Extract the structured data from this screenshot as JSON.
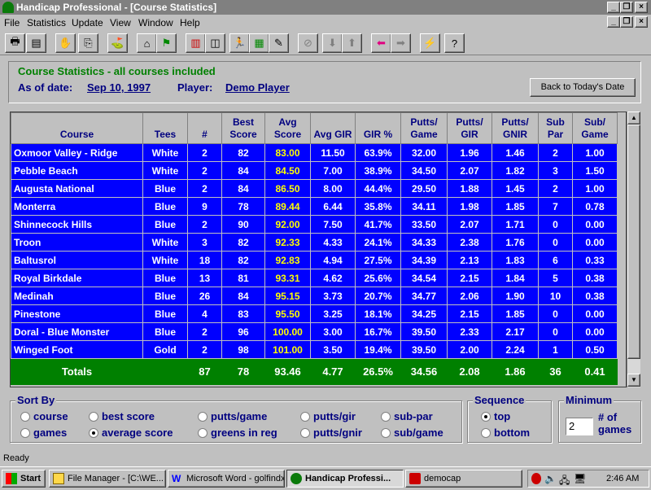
{
  "window": {
    "title": "Handicap Professional - [Course Statistics]"
  },
  "menu": [
    "File",
    "Statistics",
    "Update",
    "View",
    "Window",
    "Help"
  ],
  "header": {
    "title": "Course Statistics  -  all courses included",
    "as_of_label": "As of date:",
    "as_of_value": "Sep 10, 1997",
    "player_label": "Player:",
    "player_value": "Demo Player",
    "back_button": "Back to Today's Date"
  },
  "table": {
    "columns": [
      "Course",
      "Tees",
      "#",
      "Best Score",
      "Avg Score",
      "Avg GIR",
      "GIR %",
      "Putts/ Game",
      "Putts/ GIR",
      "Putts/ GNIR",
      "Sub Par",
      "Sub/ Game"
    ],
    "rows": [
      [
        "Oxmoor Valley - Ridge",
        "White",
        "2",
        "82",
        "83.00",
        "11.50",
        "63.9%",
        "32.00",
        "1.96",
        "1.46",
        "2",
        "1.00"
      ],
      [
        "Pebble Beach",
        "White",
        "2",
        "84",
        "84.50",
        "7.00",
        "38.9%",
        "34.50",
        "2.07",
        "1.82",
        "3",
        "1.50"
      ],
      [
        "Augusta National",
        "Blue",
        "2",
        "84",
        "86.50",
        "8.00",
        "44.4%",
        "29.50",
        "1.88",
        "1.45",
        "2",
        "1.00"
      ],
      [
        "Monterra",
        "Blue",
        "9",
        "78",
        "89.44",
        "6.44",
        "35.8%",
        "34.11",
        "1.98",
        "1.85",
        "7",
        "0.78"
      ],
      [
        "Shinnecock Hills",
        "Blue",
        "2",
        "90",
        "92.00",
        "7.50",
        "41.7%",
        "33.50",
        "2.07",
        "1.71",
        "0",
        "0.00"
      ],
      [
        "Troon",
        "White",
        "3",
        "82",
        "92.33",
        "4.33",
        "24.1%",
        "34.33",
        "2.38",
        "1.76",
        "0",
        "0.00"
      ],
      [
        "Baltusrol",
        "White",
        "18",
        "82",
        "92.83",
        "4.94",
        "27.5%",
        "34.39",
        "2.13",
        "1.83",
        "6",
        "0.33"
      ],
      [
        "Royal Birkdale",
        "Blue",
        "13",
        "81",
        "93.31",
        "4.62",
        "25.6%",
        "34.54",
        "2.15",
        "1.84",
        "5",
        "0.38"
      ],
      [
        "Medinah",
        "Blue",
        "26",
        "84",
        "95.15",
        "3.73",
        "20.7%",
        "34.77",
        "2.06",
        "1.90",
        "10",
        "0.38"
      ],
      [
        "Pinestone",
        "Blue",
        "4",
        "83",
        "95.50",
        "3.25",
        "18.1%",
        "34.25",
        "2.15",
        "1.85",
        "0",
        "0.00"
      ],
      [
        "Doral - Blue Monster",
        "Blue",
        "2",
        "96",
        "100.00",
        "3.00",
        "16.7%",
        "39.50",
        "2.33",
        "2.17",
        "0",
        "0.00"
      ],
      [
        "Winged Foot",
        "Gold",
        "2",
        "98",
        "101.00",
        "3.50",
        "19.4%",
        "39.50",
        "2.00",
        "2.24",
        "1",
        "0.50"
      ]
    ],
    "totals": [
      "Totals",
      "",
      "87",
      "78",
      "93.46",
      "4.77",
      "26.5%",
      "34.56",
      "2.08",
      "1.86",
      "36",
      "0.41"
    ]
  },
  "sort": {
    "label": "Sort By",
    "options": [
      "course",
      "games",
      "best score",
      "average score",
      "putts/game",
      "greens in reg",
      "putts/gir",
      "putts/gnir",
      "sub-par",
      "sub/game"
    ],
    "selected": "average score"
  },
  "sequence": {
    "label": "Sequence",
    "options": [
      "top",
      "bottom"
    ],
    "selected": "top"
  },
  "minimum": {
    "label": "Minimum",
    "value": "2",
    "suffix": "# of games"
  },
  "status": "Ready",
  "taskbar": {
    "start": "Start",
    "tasks": [
      "File Manager - [C:\\WE...",
      "Microsoft Word - golfindx",
      "Handicap Professi...",
      "democap"
    ],
    "clock": "2:46 AM"
  }
}
